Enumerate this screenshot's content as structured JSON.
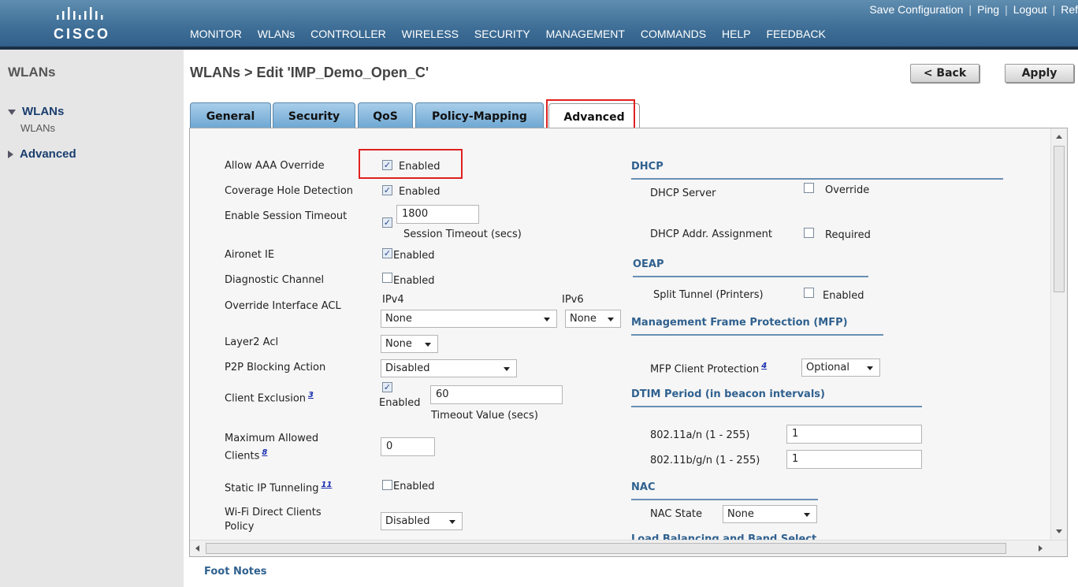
{
  "header": {
    "logo_text": "CISCO",
    "top_links": [
      "Save Configuration",
      "Ping",
      "Logout",
      "Ref"
    ],
    "nav": [
      "MONITOR",
      "WLANs",
      "CONTROLLER",
      "WIRELESS",
      "SECURITY",
      "MANAGEMENT",
      "COMMANDS",
      "HELP",
      "FEEDBACK"
    ]
  },
  "sidebar": {
    "title": "WLANs",
    "items": [
      {
        "label": "WLANs",
        "expanded": true,
        "sub": "WLANs"
      },
      {
        "label": "Advanced",
        "expanded": false
      }
    ]
  },
  "page": {
    "title": "WLANs > Edit  'IMP_Demo_Open_C'",
    "back_label": "< Back",
    "apply_label": "Apply"
  },
  "tabs": [
    "General",
    "Security",
    "QoS",
    "Policy-Mapping",
    "Advanced"
  ],
  "active_tab": "Advanced",
  "left": {
    "aaa_label": "Allow AAA Override",
    "aaa_cb": "Enabled",
    "coverage_label": "Coverage Hole Detection",
    "coverage_cb": "Enabled",
    "session_label": "Enable Session Timeout",
    "session_value": "1800",
    "session_caption": "Session Timeout (secs)",
    "aironet_label": "Aironet IE",
    "aironet_cb": "Enabled",
    "diag_label": "Diagnostic Channel",
    "diag_cb": "Enabled",
    "acl_label": "Override Interface ACL",
    "ipv4_label": "IPv4",
    "ipv6_label": "IPv6",
    "ipv4_value": "None",
    "ipv6_value": "None",
    "layer2_label": "Layer2 Acl",
    "layer2_value": "None",
    "p2p_label": "P2P Blocking Action",
    "p2p_value": "Disabled",
    "exclusion_label": "Client Exclusion",
    "exclusion_note": "3",
    "exclusion_cb": "Enabled",
    "exclusion_value": "60",
    "exclusion_caption": "Timeout Value (secs)",
    "max_label": "Maximum Allowed Clients",
    "max_note": "8",
    "max_value": "0",
    "static_label": "Static IP Tunneling",
    "static_note": "11",
    "static_cb": "Enabled",
    "wifi_label": "Wi-Fi Direct Clients Policy",
    "wifi_value": "Disabled"
  },
  "right": {
    "dhcp_section": "DHCP",
    "dhcp_server_label": "DHCP Server",
    "dhcp_server_cb": "Override",
    "dhcp_addr_label": "DHCP Addr. Assignment",
    "dhcp_addr_cb": "Required",
    "oeap_section": "OEAP",
    "split_label": "Split Tunnel (Printers)",
    "split_cb": "Enabled",
    "mfp_section": "Management Frame Protection (MFP)",
    "mfp_label": "MFP Client Protection",
    "mfp_note": "4",
    "mfp_value": "Optional",
    "dtim_section": "DTIM Period (in beacon intervals)",
    "dtim_a_label": "802.11a/n (1 - 255)",
    "dtim_a_value": "1",
    "dtim_b_label": "802.11b/g/n (1 - 255)",
    "dtim_b_value": "1",
    "nac_section": "NAC",
    "nac_label": "NAC State",
    "nac_value": "None",
    "lb_section": "Load Balancing and Band Select"
  },
  "footer": {
    "foot_notes": "Foot Notes"
  },
  "colors": {
    "highlight": "#e02020",
    "section": "#30618f",
    "header": "#3f6f97"
  }
}
